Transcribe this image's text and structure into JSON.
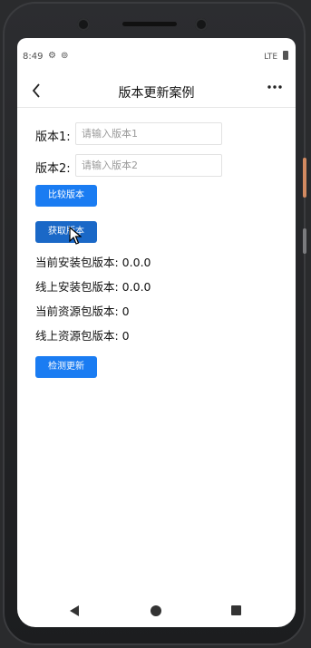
{
  "status_bar": {
    "time": "8:49",
    "network": "LTE"
  },
  "nav": {
    "title": "版本更新案例",
    "back_glyph": "<",
    "more_glyph": "•••"
  },
  "form": {
    "version1_label": "版本1:",
    "version1_placeholder": "请输入版本1",
    "version2_label": "版本2:",
    "version2_placeholder": "请输入版本2",
    "compare_button": "比较版本",
    "fetch_button": "获取版本"
  },
  "info": {
    "current_install": "当前安装包版本: 0.0.0",
    "online_install": "线上安装包版本: 0.0.0",
    "current_resource": "当前资源包版本: 0",
    "online_resource": "线上资源包版本: 0"
  },
  "check_update_button": "检测更新",
  "colors": {
    "button_blue": "#1a7cf2",
    "pressed_blue": "#1a68c7"
  },
  "icons": {
    "settings": "gear-icon",
    "sync": "sync-icon",
    "battery": "battery-icon",
    "cursor": "mouse-cursor-icon"
  }
}
